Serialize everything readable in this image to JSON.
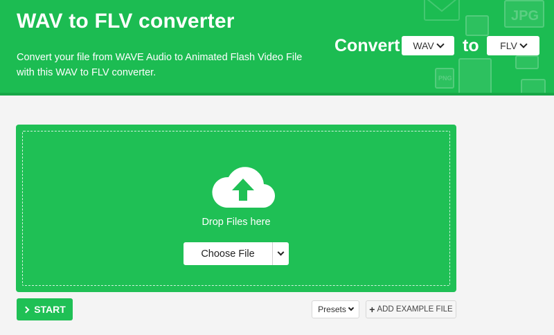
{
  "header": {
    "title": "WAV to FLV converter",
    "subtitle": "Convert your file from WAVE Audio to Animated Flash Video File with this WAV to FLV converter.",
    "convert_label": "Convert",
    "to_label": "to",
    "from_format": "WAV",
    "to_format": "FLV",
    "decor_labels": [
      "JPG",
      "PNG"
    ]
  },
  "dropzone": {
    "text": "Drop Files here",
    "choose_label": "Choose File"
  },
  "actions": {
    "start_label": "START",
    "presets_label": "Presets",
    "example_label": "ADD EXAMPLE FILE"
  },
  "colors": {
    "brand_green": "#1cbc52",
    "dropzone_green": "#1fc055",
    "page_background": "#f4f4f4"
  },
  "icons": [
    "cloud-upload-icon",
    "chevron-down-icon",
    "chevron-right-icon",
    "plus-icon",
    "mail-icon",
    "image-file-icon",
    "printer-icon"
  ]
}
